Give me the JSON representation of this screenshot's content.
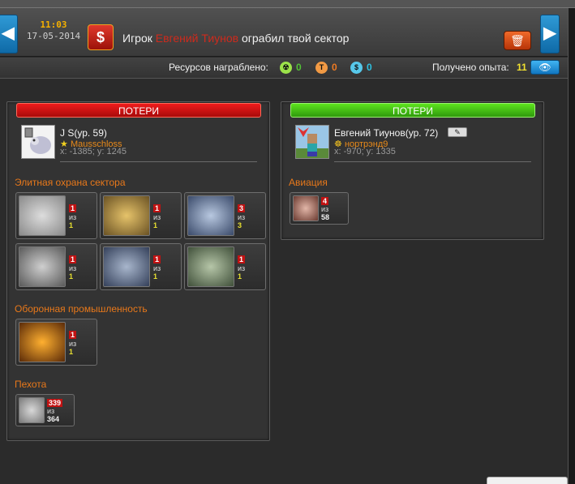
{
  "header": {
    "time": "11:03",
    "date": "17-05-2014",
    "message_prefix": "Игрок",
    "player_name": "Евгений Тиунов",
    "message_suffix": "ограбил твой сектор",
    "rob_icon": "$",
    "nav_left_icon": "◀",
    "nav_right_icon": "▶",
    "trash_icon": "🗑"
  },
  "rewards": {
    "label": "Ресурсов награблено:",
    "resources": [
      {
        "icon": "radiation-icon",
        "glyph": "☢",
        "value": "0",
        "color": "#52c236"
      },
      {
        "icon": "titanium-icon",
        "glyph": "T",
        "value": "0",
        "color": "#ef7a22"
      },
      {
        "icon": "credits-icon",
        "glyph": "$",
        "value": "0",
        "color": "#2ec0e0"
      }
    ],
    "exp_label": "Получено опыта:",
    "exp_value": "11",
    "eye_icon": "👁"
  },
  "left_panel": {
    "title": "ПОТЕРИ",
    "player": {
      "name": "J S(ур. 59)",
      "guild": "Mausschloss",
      "coords": "x: -1385; y: 1245"
    },
    "sections": [
      {
        "title": "Элитная охрана сектора",
        "units": [
          {
            "lost": "1",
            "of": "из",
            "total": "1"
          },
          {
            "lost": "1",
            "of": "из",
            "total": "1"
          },
          {
            "lost": "3",
            "of": "из",
            "total": "3"
          },
          {
            "lost": "1",
            "of": "из",
            "total": "1"
          },
          {
            "lost": "1",
            "of": "из",
            "total": "1"
          },
          {
            "lost": "1",
            "of": "из",
            "total": "1"
          }
        ]
      },
      {
        "title": "Оборонная промышленность",
        "units": [
          {
            "lost": "1",
            "of": "из",
            "total": "1"
          }
        ]
      },
      {
        "title": "Пехота",
        "units": [
          {
            "lost": "339",
            "of": "из",
            "total": "364"
          }
        ]
      }
    ]
  },
  "right_panel": {
    "title": "ПОТЕРИ",
    "player": {
      "name": "Евгений Тиунов(ур. 72)",
      "guild": "нортрэнд9",
      "coords": "x: -970; y: 1335"
    },
    "sections": [
      {
        "title": "Авиация",
        "units": [
          {
            "lost": "4",
            "of": "из",
            "total": "58"
          }
        ]
      }
    ]
  }
}
